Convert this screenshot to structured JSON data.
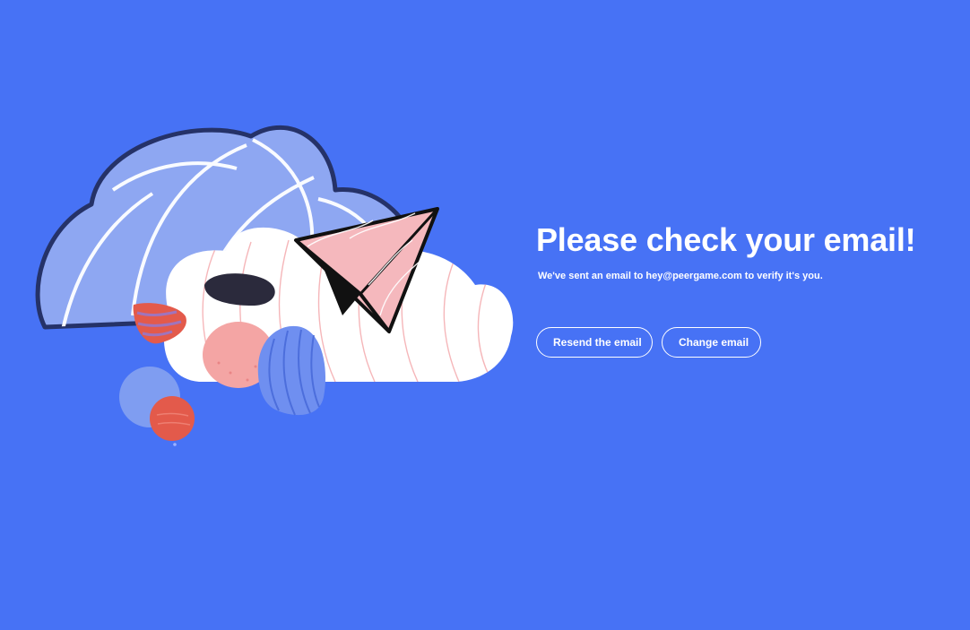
{
  "page": {
    "title": "Please check your email!",
    "subtitle": "We've sent an email to hey@peergame.com to verify it's you."
  },
  "actions": {
    "resend_label": "Resend the email",
    "change_label": "Change email"
  },
  "colors": {
    "background": "#4772f5",
    "text": "#ffffff",
    "cloud_back": "#8ea7f2",
    "cloud_front": "#ffffff",
    "accent_red": "#e35a4b",
    "accent_pink": "#f4a5a4",
    "plane": "#f5b8bd"
  },
  "icons": {
    "illustration": "cloud-paper-plane-illustration"
  }
}
